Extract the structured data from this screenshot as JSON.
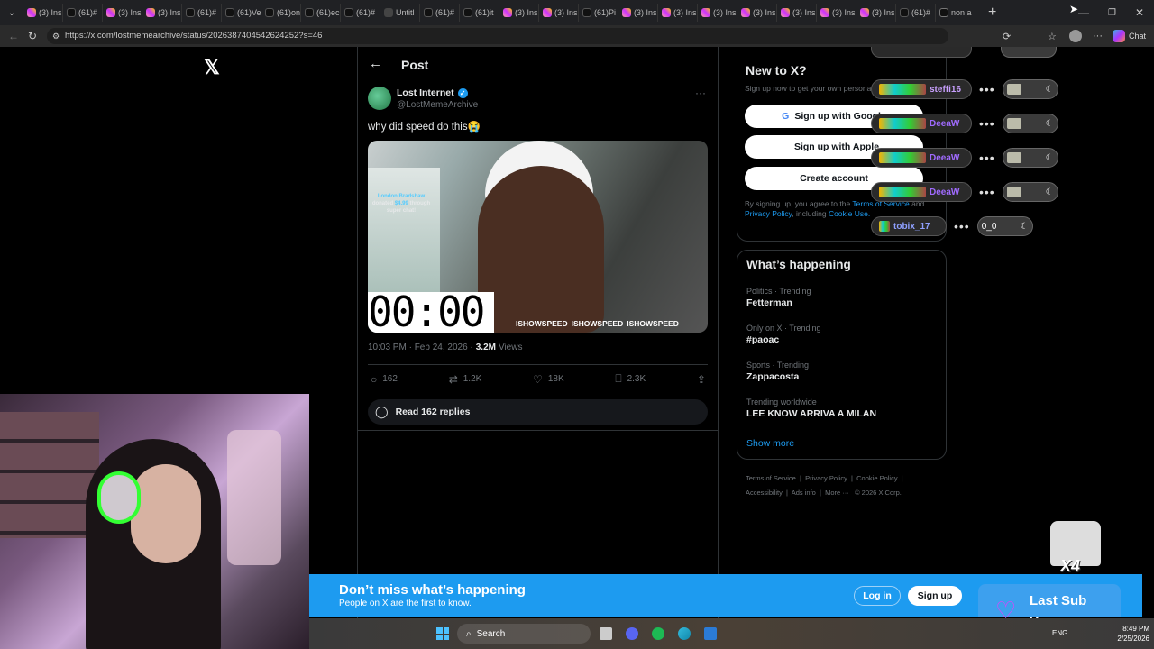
{
  "browser": {
    "tabs": [
      {
        "icon": "instagram-icon",
        "label": "(3) Ins"
      },
      {
        "icon": "tiktok-icon",
        "label": "(61)#"
      },
      {
        "icon": "instagram-icon",
        "label": "(3) Ins"
      },
      {
        "icon": "instagram-icon",
        "label": "(3) Ins"
      },
      {
        "icon": "tiktok-icon",
        "label": "(61)#"
      },
      {
        "icon": "tiktok-icon",
        "label": "(61)Ve"
      },
      {
        "icon": "tiktok-icon",
        "label": "(61)on"
      },
      {
        "icon": "tiktok-icon",
        "label": "(61)ec"
      },
      {
        "icon": "tiktok-icon",
        "label": "(61)#"
      },
      {
        "icon": "mail-icon",
        "label": "Untitl"
      },
      {
        "icon": "tiktok-icon",
        "label": "(61)#"
      },
      {
        "icon": "tiktok-icon",
        "label": "(61)it"
      },
      {
        "icon": "instagram-icon",
        "label": "(3) Ins"
      },
      {
        "icon": "instagram-icon",
        "label": "(3) Ins"
      },
      {
        "icon": "tiktok-icon",
        "label": "(61)Pi"
      },
      {
        "icon": "instagram-icon",
        "label": "(3) Ins"
      },
      {
        "icon": "instagram-icon",
        "label": "(3) Ins"
      },
      {
        "icon": "instagram-icon",
        "label": "(3) Ins"
      },
      {
        "icon": "instagram-icon",
        "label": "(3) Ins"
      },
      {
        "icon": "instagram-icon",
        "label": "(3) Ins"
      },
      {
        "icon": "instagram-icon",
        "label": "(3) Ins"
      },
      {
        "icon": "instagram-icon",
        "label": "(3) Ins"
      },
      {
        "icon": "tiktok-icon",
        "label": "(61)#"
      },
      {
        "icon": "x-icon",
        "label": "non a"
      }
    ],
    "url": "https://x.com/lostmemearchive/status/2026387404542624252?s=46",
    "chat_label": "Chat"
  },
  "x": {
    "logo": "𝕏",
    "header": {
      "title": "Post"
    },
    "post": {
      "display_name": "Lost Internet",
      "handle": "@LostMemeArchive",
      "text": "why did speed do this😭",
      "timestamp": "10:03 PM · Feb 24, 2026 ·",
      "views_count": "3.2M",
      "views_label": "Views",
      "media": {
        "timer": "00:00",
        "donation_name": "London Bradshaw",
        "donation_text_1": "donated",
        "donation_amount": "$4.99",
        "donation_text_2": "through",
        "donation_text_3": "super chat!",
        "watermark": "ISHOWSPEED"
      },
      "stats": {
        "replies": "162",
        "reposts": "1.2K",
        "likes": "18K",
        "bookmarks": "2.3K"
      },
      "read_replies": "Read 162 replies"
    },
    "signup": {
      "title": "New to X?",
      "subtitle": "Sign up now to get your own personalized timeline!",
      "google": "Sign up with Google",
      "apple": "Sign up with Apple",
      "create": "Create account",
      "legal_1": "By signing up, you agree to the",
      "terms": "Terms of Service",
      "legal_and": "and",
      "privacy": "Privacy Policy",
      "legal_2": ", including",
      "cookie": "Cookie Use."
    },
    "trends": {
      "title": "What’s happening",
      "items": [
        {
          "category": "Politics · Trending",
          "name": "Fetterman"
        },
        {
          "category": "Only on X · Trending",
          "name": "#paoac"
        },
        {
          "category": "Sports · Trending",
          "name": "Zappacosta"
        },
        {
          "category": "Trending worldwide",
          "name": "LEE KNOW ARRIVA A MILAN"
        }
      ],
      "show_more": "Show more"
    },
    "footer": {
      "terms": "Terms of Service",
      "privacy": "Privacy Policy",
      "cookie": "Cookie Policy",
      "accessibility": "Accessibility",
      "ads": "Ads info",
      "more": "More ···",
      "copyright": "© 2026 X Corp."
    },
    "banner": {
      "title": "Don’t miss what’s happening",
      "subtitle": "People on X are the first to know.",
      "login": "Log in",
      "signup": "Sign up"
    }
  },
  "overlay": {
    "users": [
      {
        "name": "steffi16",
        "color": "#c9a0ff"
      },
      {
        "name": "DeeaW",
        "color": "#a06bff"
      },
      {
        "name": "DeeaW",
        "color": "#a06bff"
      },
      {
        "name": "DeeaW",
        "color": "#a06bff"
      },
      {
        "name": "tobix_17",
        "color": "#8fa0ff"
      }
    ],
    "last_toggle": "0_0",
    "x4": "X4",
    "last_sub_label": "Last Sub",
    "last_sub_name": "Yeoana"
  },
  "taskbar": {
    "search": "Search",
    "lang": "ENG",
    "time": "8:49 PM",
    "date": "2/25/2026"
  },
  "colors": {
    "accent": "#1d9bf0",
    "background": "#000000",
    "border": "#2f3336",
    "muted": "#71767b"
  }
}
